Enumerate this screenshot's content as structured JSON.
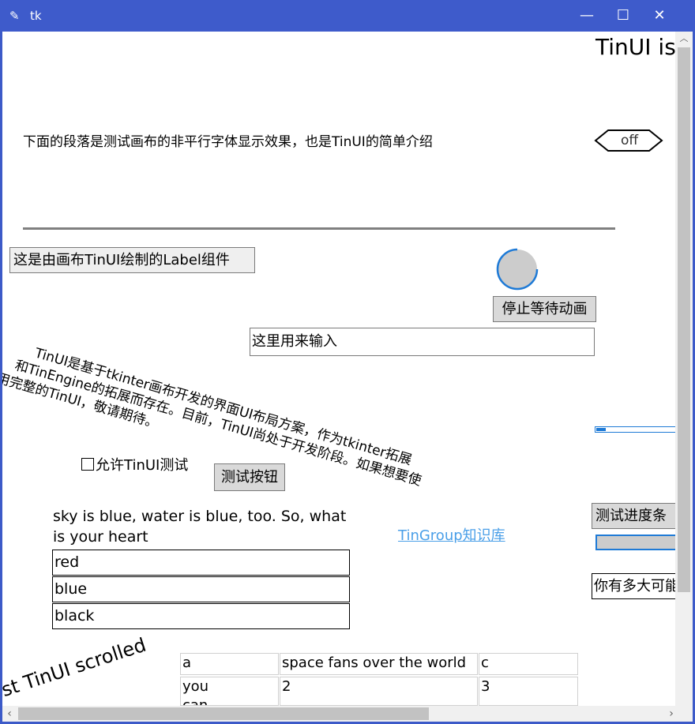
{
  "window": {
    "title": "tk"
  },
  "controls": {
    "minimize": "—",
    "maximize": "☐",
    "close": "✕"
  },
  "header": {
    "title_text": "TinUI is"
  },
  "intro": {
    "text": "下面的段落是测试画布的非平行字体显示效果，也是TinUI的简单介绍"
  },
  "switch": {
    "label": "off"
  },
  "label_widget": {
    "text": "这是由画布TinUI绘制的Label组件"
  },
  "wait_animation": {
    "button_label": "停止等待动画"
  },
  "entry": {
    "value": "这里用来输入"
  },
  "rotated_paragraph": {
    "line1": "TinUI是基于tkinter画布开发的界面UI布局方案，作为tkinter拓展",
    "line2": "和TinEngine的拓展而存在。目前，TinUI尚处于开发阶段。如果想要使",
    "line3": "用完整的TinUI，敬请期待。"
  },
  "checkbox": {
    "label": "允许TinUI测试",
    "checked": false
  },
  "test_button": {
    "label": "测试按钮"
  },
  "progress": {
    "button_label": "测试进度条",
    "fraction": 0.0
  },
  "question": {
    "text_line1": "sky is blue, water is blue, too. So, what",
    "text_line2": "is your heart",
    "options": [
      "red",
      "blue",
      "black"
    ]
  },
  "link": {
    "text": "TinGroup知识库"
  },
  "partial_entry": {
    "value": "你有多大可能"
  },
  "scrolled_text": {
    "text": "test TinUI scrolled"
  },
  "table": {
    "headers": [
      "a",
      "space fans over the world",
      "c"
    ],
    "rows": [
      [
        "you",
        "2",
        "3"
      ],
      [
        "can",
        "",
        ""
      ]
    ]
  },
  "colors": {
    "titlebar": "#3e5bcb",
    "link": "#4a9fe8",
    "spinner": "#1e7ad6"
  },
  "icons": {
    "app": "feather-icon",
    "scroll_up": "chevron-up-icon",
    "scroll_left": "chevron-left-icon",
    "scroll_right": "chevron-right-icon"
  }
}
